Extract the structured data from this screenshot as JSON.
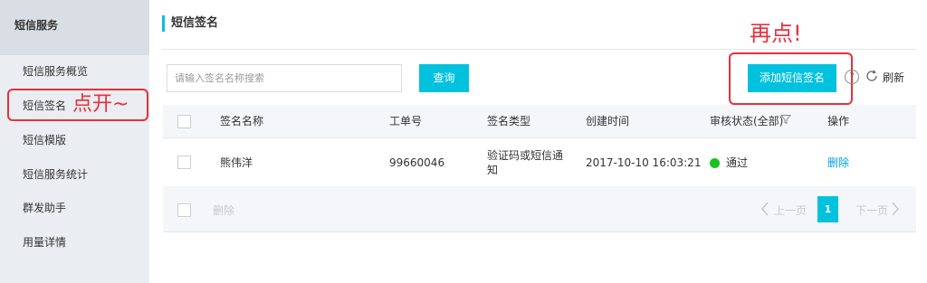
{
  "sidebar": {
    "header": "短信服务",
    "items": [
      {
        "label": "短信服务概览"
      },
      {
        "label": "短信签名"
      },
      {
        "label": "短信模版"
      },
      {
        "label": "短信服务统计"
      },
      {
        "label": "群发助手"
      },
      {
        "label": "用量详情"
      }
    ]
  },
  "annotations": {
    "sidebar_note": "点开~",
    "add_note": "再点!",
    "color": "#e8303b"
  },
  "main": {
    "title": "短信签名",
    "search": {
      "placeholder": "请输入签名名称搜索"
    },
    "query_label": "查询",
    "add_label": "添加短信签名",
    "help_icon": "question-circle-icon",
    "refresh_icon": "refresh-icon",
    "refresh_label": "刷新"
  },
  "table": {
    "columns": {
      "name": "签名名称",
      "order": "工单号",
      "type": "签名类型",
      "created": "创建时间",
      "status": "审核状态(全部)",
      "action": "操作"
    },
    "rows": [
      {
        "name": "熊伟洋",
        "order": "99660046",
        "type_line1": "验证码或短信通",
        "type_line2": "知",
        "created": "2017-10-10 16:03:21",
        "status": "通过",
        "status_color": "#1dc11d",
        "action": "删除"
      }
    ]
  },
  "footer": {
    "batch_delete": "删除",
    "prev": "上一页",
    "page": "1",
    "next": "下一页"
  },
  "colors": {
    "accent": "#00c1de",
    "link": "#00a0e9"
  }
}
